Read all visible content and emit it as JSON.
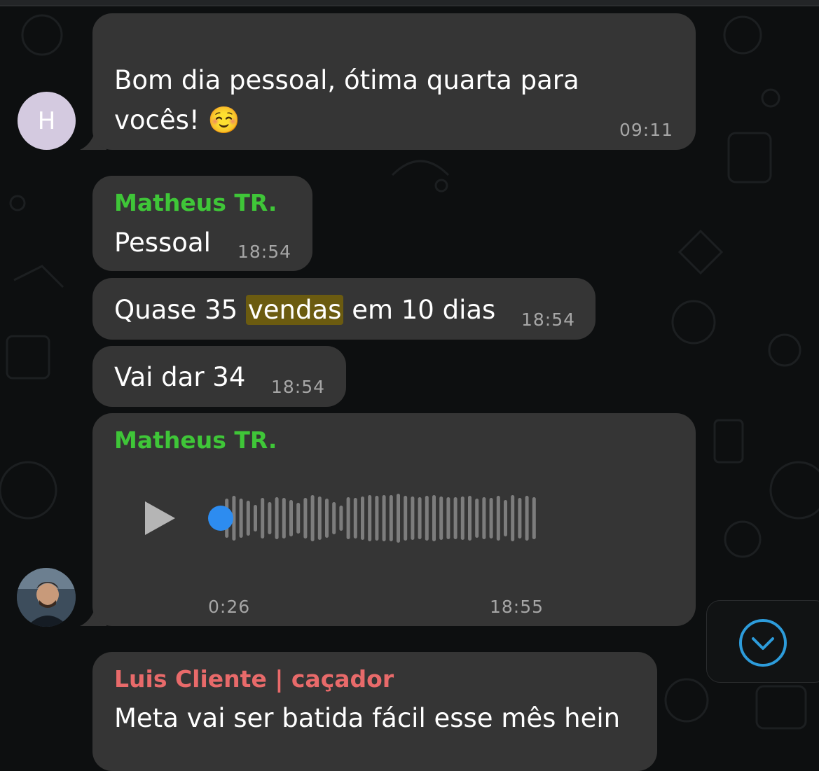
{
  "messages": [
    {
      "id": "m1",
      "avatar_initial": "H",
      "text_line1": "Bom dia pessoal, ótima quarta para",
      "text_line2": "vocês! ",
      "emoji": "☺️",
      "time": "09:11"
    },
    {
      "id": "m2",
      "sender": "Matheus TR.",
      "text": "Pessoal",
      "time": "18:54"
    },
    {
      "id": "m3",
      "text_before": "Quase 35 ",
      "text_highlight": "vendas",
      "text_after": " em 10 dias",
      "time": "18:54"
    },
    {
      "id": "m4",
      "text": "Vai dar 34",
      "time": "18:54"
    },
    {
      "id": "m5",
      "sender": "Matheus TR.",
      "type": "voice",
      "duration": "0:26",
      "time": "18:55",
      "progress": 0
    },
    {
      "id": "m6",
      "sender": "Luis Cliente | caçador",
      "text": "Meta vai ser batida fácil esse mês hein"
    }
  ],
  "colors": {
    "matheus_name": "#3fc638",
    "luis_name": "#e86a6a",
    "bubble": "#353535",
    "highlight": "#6b5b10",
    "voice_dot": "#2d8cf0",
    "scroll_icon": "#2d9cdb"
  },
  "icons": {
    "play": "play-icon",
    "scroll_down": "chevron-down-circle-icon"
  }
}
